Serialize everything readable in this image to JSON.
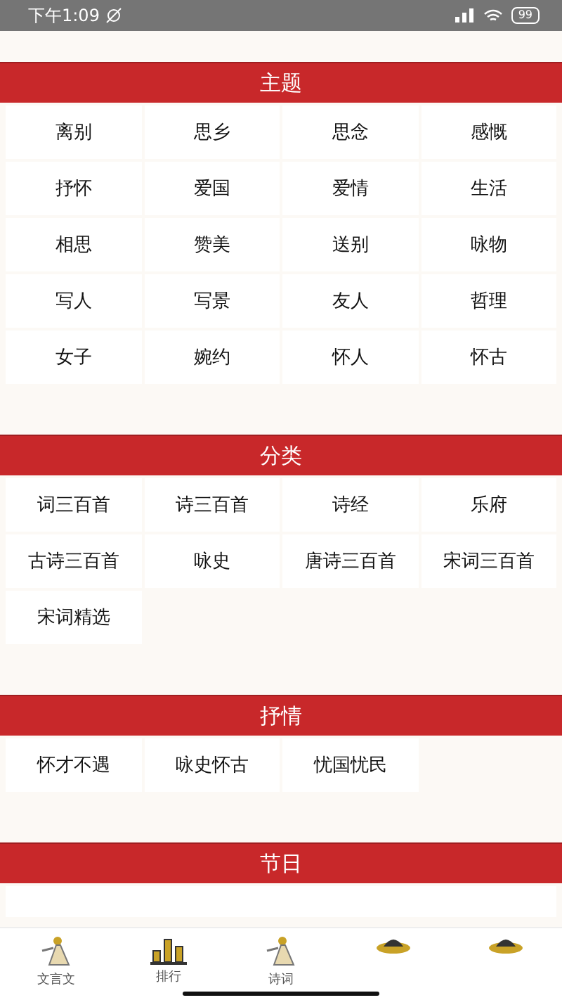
{
  "status_bar": {
    "time": "下午1:09",
    "battery": "99"
  },
  "sections": [
    {
      "title": "主题",
      "items": [
        "离别",
        "思乡",
        "思念",
        "感慨",
        "抒怀",
        "爱国",
        "爱情",
        "生活",
        "相思",
        "赞美",
        "送别",
        "咏物",
        "写人",
        "写景",
        "友人",
        "哲理",
        "女子",
        "婉约",
        "怀人",
        "怀古"
      ]
    },
    {
      "title": "分类",
      "items": [
        "词三百首",
        "诗三百首",
        "诗经",
        "乐府",
        "古诗三百首",
        "咏史",
        "唐诗三百首",
        "宋词三百首",
        "宋词精选"
      ]
    },
    {
      "title": "抒情",
      "items": [
        "怀才不遇",
        "咏史怀古",
        "忧国忧民"
      ]
    },
    {
      "title": "节日"
    }
  ],
  "bottom_nav": [
    {
      "label": "文言文",
      "kind": "figure"
    },
    {
      "label": "排行",
      "kind": "bars"
    },
    {
      "label": "诗词",
      "kind": "figure"
    },
    {
      "kind": "hat"
    },
    {
      "kind": "hat"
    }
  ]
}
